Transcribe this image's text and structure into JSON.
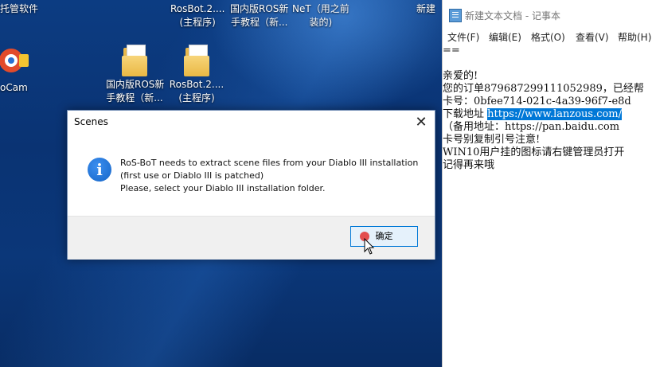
{
  "desktop": {
    "top_items": [
      {
        "label": "托管软件"
      },
      {
        "label_line1": "RosBot.2....",
        "label_line2": "(主程序)"
      },
      {
        "label_line1": "国内版ROS新",
        "label_line2": "手教程（新..."
      },
      {
        "label_line1": "NeT（用之前",
        "label_line2": "装的)"
      },
      {
        "label": "新建"
      }
    ],
    "icons": [
      {
        "label": "oCam",
        "icon": "ocam-app-icon"
      },
      {
        "label_line1": "国内版ROS新",
        "label_line2": "手教程（新...",
        "icon": "folder-icon"
      },
      {
        "label_line1": "RosBot.2....",
        "label_line2": "(主程序)",
        "icon": "folder-icon"
      }
    ]
  },
  "dialog": {
    "title": "Scenes",
    "close_glyph": "✕",
    "icon": "info-icon",
    "icon_glyph": "i",
    "message_lines": [
      "RoS-BoT needs to extract scene files from your Diablo III installation",
      "(first use or Diablo III is patched)",
      "Please, select your Diablo III installation folder."
    ],
    "ok_label": "确定"
  },
  "notepad": {
    "title": "新建文本文档 - 记事本",
    "menu": [
      "文件(F)",
      "编辑(E)",
      "格式(O)",
      "查看(V)",
      "帮助(H)"
    ],
    "lines": [
      "==",
      "",
      "亲爱的!",
      "您的订单879687299111052989，已经帮",
      "卡号：0bfee714-021c-4a39-96f7-e8d",
      "下载地址 ",
      "（备用地址：https://pan.baidu.com",
      "卡号别复制引号注意!",
      "WIN10用户挂的图标请右键管理员打开",
      "记得再来哦"
    ],
    "download_link_selected": "https://www.lanzous.com/"
  },
  "colors": {
    "desktop_bg": "#0b3779",
    "selection": "#0078d7",
    "info_icon": "#1565c7",
    "ok_border": "#0078d7"
  }
}
